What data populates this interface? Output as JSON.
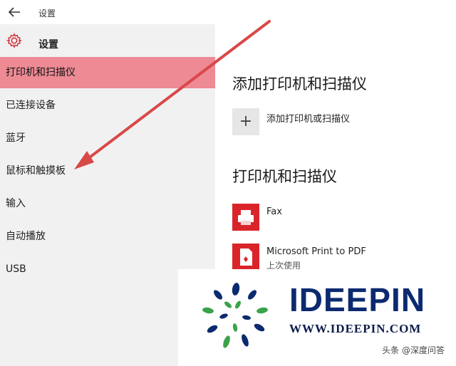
{
  "window": {
    "title": "设置"
  },
  "app": {
    "title": "设置"
  },
  "sidebar": {
    "items": [
      {
        "label": "打印机和扫描仪",
        "active": true
      },
      {
        "label": "已连接设备",
        "active": false
      },
      {
        "label": "蓝牙",
        "active": false
      },
      {
        "label": "鼠标和触摸板",
        "active": false
      },
      {
        "label": "输入",
        "active": false
      },
      {
        "label": "自动播放",
        "active": false
      },
      {
        "label": "USB",
        "active": false
      }
    ]
  },
  "main": {
    "add_heading": "添加打印机和扫描仪",
    "add_label": "添加打印机或扫描仪",
    "list_heading": "打印机和扫描仪",
    "printers": [
      {
        "name": "Fax",
        "status": ""
      },
      {
        "name": "Microsoft Print to PDF",
        "status": "上次使用"
      }
    ]
  },
  "watermark": {
    "brand": "IDEEPIN",
    "url": "WWW.IDEEPIN.COM",
    "tag": "头条 @深度问答"
  },
  "colors": {
    "accent_active": "#ed8a94",
    "arrow": "#d94848",
    "printer_icon": "#d9252a",
    "brand_blue": "#0b2a6f",
    "brand_green": "#3aa34a"
  }
}
